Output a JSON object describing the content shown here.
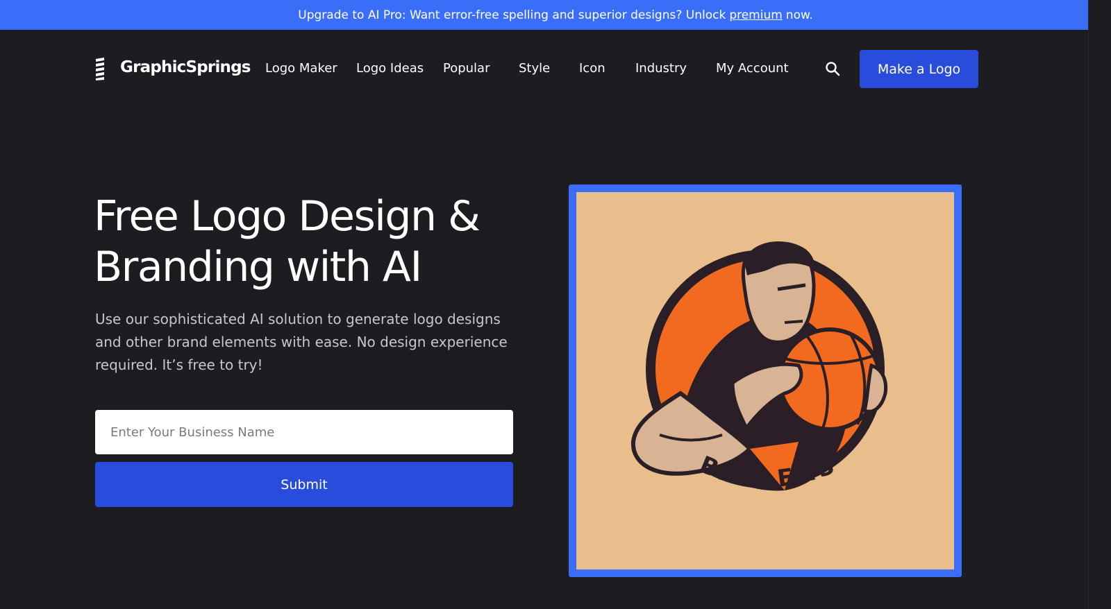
{
  "promo": {
    "text_before": "Upgrade to AI Pro: Want error-free spelling and superior designs? Unlock",
    "link_text": "premium",
    "text_after": "now."
  },
  "header": {
    "brand": "GraphicSprings",
    "nav": [
      {
        "label": "Logo Maker"
      },
      {
        "label": "Logo Ideas"
      },
      {
        "label": "Popular"
      },
      {
        "label": "Style"
      },
      {
        "label": "Icon"
      },
      {
        "label": "Industry"
      },
      {
        "label": "My Account"
      }
    ],
    "search_icon": "search-icon",
    "cta_label": "Make a Logo"
  },
  "hero": {
    "title_line1": "Free Logo Design &",
    "title_line2": "Branding with AI",
    "subtitle": "Use our sophisticated AI solution to generate logo designs and other brand elements with ease. No design experience required. It’s free to try!",
    "input_placeholder": "Enter Your Business Name",
    "submit_label": "Submit"
  },
  "showcase": {
    "logo_text": "BALLERS"
  },
  "colors": {
    "promo_bg": "#3b6ef8",
    "page_bg": "#1c1c21",
    "button_blue": "#2a4cdc",
    "frame_blue": "#3b6ef8",
    "image_bg": "#e9bd8c",
    "ball_orange": "#f26a1f"
  }
}
